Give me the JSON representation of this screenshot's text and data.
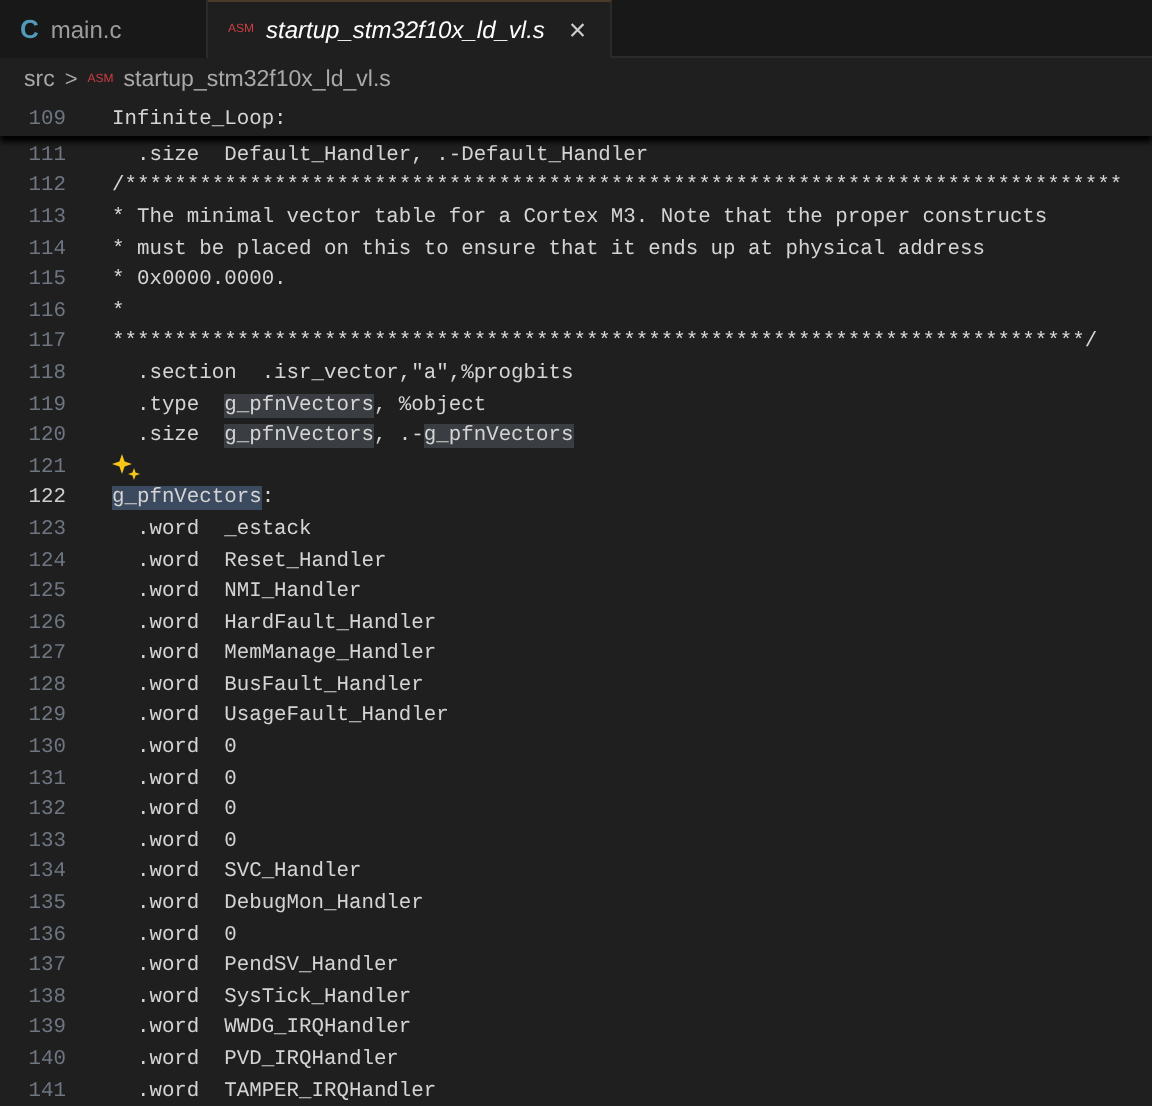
{
  "tabs": [
    {
      "icon": "C",
      "color": "#519aba",
      "label": "main.c",
      "selected": false
    },
    {
      "icon": "ASM",
      "color": "#cc3e44",
      "label": "startup_stm32f10x_ld_vl.s",
      "selected": true,
      "close": "×"
    }
  ],
  "breadcrumb": {
    "folder": "src",
    "separator": ">",
    "icon": "ASM",
    "color": "#cc3e44",
    "file": "startup_stm32f10x_ld_vl.s"
  },
  "sticky_line": {
    "number": "109",
    "text": "Infinite_Loop:"
  },
  "lines": [
    {
      "number": "111",
      "kind": "code",
      "segments": [
        {
          "kind": "plain",
          "text": "  .size  Default_Handler, .-Default_Handler"
        }
      ]
    },
    {
      "number": "112",
      "kind": "code",
      "segments": [
        {
          "kind": "plain",
          "text": "/********************************************************************************"
        }
      ]
    },
    {
      "number": "113",
      "kind": "code",
      "segments": [
        {
          "kind": "plain",
          "text": "* The minimal vector table for a Cortex M3. Note that the proper constructs"
        }
      ]
    },
    {
      "number": "114",
      "kind": "code",
      "segments": [
        {
          "kind": "plain",
          "text": "* must be placed on this to ensure that it ends up at physical address"
        }
      ]
    },
    {
      "number": "115",
      "kind": "code",
      "segments": [
        {
          "kind": "plain",
          "text": "* 0x0000.0000."
        }
      ]
    },
    {
      "number": "116",
      "kind": "code",
      "segments": [
        {
          "kind": "plain",
          "text": "*"
        }
      ]
    },
    {
      "number": "117",
      "kind": "code",
      "segments": [
        {
          "kind": "plain",
          "text": "******************************************************************************/"
        }
      ]
    },
    {
      "number": "118",
      "kind": "code",
      "segments": [
        {
          "kind": "plain",
          "text": "  .section  .isr_vector,\"a\",%progbits"
        }
      ]
    },
    {
      "number": "119",
      "kind": "code",
      "segments": [
        {
          "kind": "plain",
          "text": "  .type  "
        },
        {
          "kind": "match",
          "text": "g_pfnVectors"
        },
        {
          "kind": "plain",
          "text": ", %object"
        }
      ]
    },
    {
      "number": "120",
      "kind": "code",
      "segments": [
        {
          "kind": "plain",
          "text": "  .size  "
        },
        {
          "kind": "match",
          "text": "g_pfnVectors"
        },
        {
          "kind": "plain",
          "text": ", .-"
        },
        {
          "kind": "match",
          "text": "g_pfnVectors"
        }
      ]
    },
    {
      "number": "121",
      "kind": "sparkle"
    },
    {
      "number": "122",
      "kind": "code",
      "current": true,
      "segments": [
        {
          "kind": "selected",
          "text": "g_pfnVectors"
        },
        {
          "kind": "plain",
          "text": ":"
        }
      ]
    },
    {
      "number": "123",
      "kind": "code",
      "segments": [
        {
          "kind": "plain",
          "text": "  .word  _estack"
        }
      ]
    },
    {
      "number": "124",
      "kind": "code",
      "segments": [
        {
          "kind": "plain",
          "text": "  .word  Reset_Handler"
        }
      ]
    },
    {
      "number": "125",
      "kind": "code",
      "segments": [
        {
          "kind": "plain",
          "text": "  .word  NMI_Handler"
        }
      ]
    },
    {
      "number": "126",
      "kind": "code",
      "segments": [
        {
          "kind": "plain",
          "text": "  .word  HardFault_Handler"
        }
      ]
    },
    {
      "number": "127",
      "kind": "code",
      "segments": [
        {
          "kind": "plain",
          "text": "  .word  MemManage_Handler"
        }
      ]
    },
    {
      "number": "128",
      "kind": "code",
      "segments": [
        {
          "kind": "plain",
          "text": "  .word  BusFault_Handler"
        }
      ]
    },
    {
      "number": "129",
      "kind": "code",
      "segments": [
        {
          "kind": "plain",
          "text": "  .word  UsageFault_Handler"
        }
      ]
    },
    {
      "number": "130",
      "kind": "code",
      "segments": [
        {
          "kind": "plain",
          "text": "  .word  0"
        }
      ]
    },
    {
      "number": "131",
      "kind": "code",
      "segments": [
        {
          "kind": "plain",
          "text": "  .word  0"
        }
      ]
    },
    {
      "number": "132",
      "kind": "code",
      "segments": [
        {
          "kind": "plain",
          "text": "  .word  0"
        }
      ]
    },
    {
      "number": "133",
      "kind": "code",
      "segments": [
        {
          "kind": "plain",
          "text": "  .word  0"
        }
      ]
    },
    {
      "number": "134",
      "kind": "code",
      "segments": [
        {
          "kind": "plain",
          "text": "  .word  SVC_Handler"
        }
      ]
    },
    {
      "number": "135",
      "kind": "code",
      "segments": [
        {
          "kind": "plain",
          "text": "  .word  DebugMon_Handler"
        }
      ]
    },
    {
      "number": "136",
      "kind": "code",
      "segments": [
        {
          "kind": "plain",
          "text": "  .word  0"
        }
      ]
    },
    {
      "number": "137",
      "kind": "code",
      "segments": [
        {
          "kind": "plain",
          "text": "  .word  PendSV_Handler"
        }
      ]
    },
    {
      "number": "138",
      "kind": "code",
      "segments": [
        {
          "kind": "plain",
          "text": "  .word  SysTick_Handler"
        }
      ]
    },
    {
      "number": "139",
      "kind": "code",
      "segments": [
        {
          "kind": "plain",
          "text": "  .word  WWDG_IRQHandler"
        }
      ]
    },
    {
      "number": "140",
      "kind": "code",
      "segments": [
        {
          "kind": "plain",
          "text": "  .word  PVD_IRQHandler"
        }
      ]
    },
    {
      "number": "141",
      "kind": "code",
      "segments": [
        {
          "kind": "plain",
          "text": "  .word  TAMPER_IRQHandler"
        }
      ]
    }
  ]
}
